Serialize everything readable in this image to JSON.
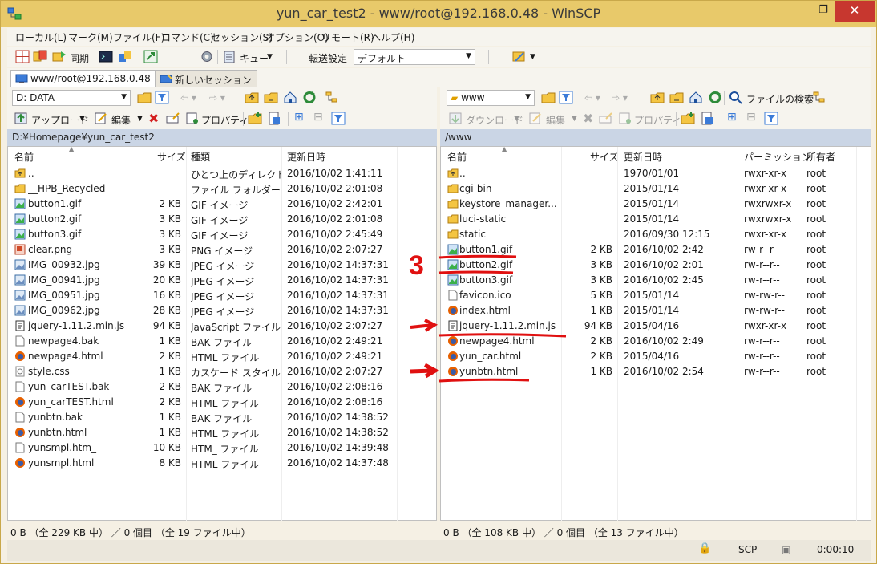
{
  "window": {
    "title": "yun_car_test2 - www/root@192.168.0.48 - WinSCP",
    "minimize_glyph": "—",
    "maximize_glyph": "❐",
    "close_glyph": "✕"
  },
  "menu": [
    "ローカル(L)",
    "マーク(M)",
    "ファイル(F)",
    "コマンド(C)",
    "セッション(S)",
    "オプション(O)",
    "リモート(R)",
    "ヘルプ(H)"
  ],
  "toolbar": {
    "sync_label": "同期",
    "queue_label": "キュー",
    "transfer_label": "転送設定",
    "transfer_value": "デフォルト"
  },
  "tabs": {
    "session": "www/root@192.168.0.48",
    "new_session": "新しいセッション"
  },
  "left": {
    "drive": "D: DATA",
    "upload_label": "アップロード",
    "edit_label": "編集",
    "properties_label": "プロパティ",
    "path": "D:¥Homepage¥yun_car_test2",
    "columns": {
      "name": "名前",
      "size": "サイズ",
      "type": "種類",
      "modified": "更新日時"
    },
    "files": [
      {
        "name": "..",
        "size": "",
        "type": "ひとつ上のディレクトリ",
        "modified": "2016/10/02  1:41:11",
        "icon": "up-dir"
      },
      {
        "name": "__HPB_Recycled",
        "size": "",
        "type": "ファイル フォルダー",
        "modified": "2016/10/02  2:01:08",
        "icon": "folder"
      },
      {
        "name": "button1.gif",
        "size": "2 KB",
        "type": "GIF イメージ",
        "modified": "2016/10/02  2:42:01",
        "icon": "image"
      },
      {
        "name": "button2.gif",
        "size": "3 KB",
        "type": "GIF イメージ",
        "modified": "2016/10/02  2:01:08",
        "icon": "image"
      },
      {
        "name": "button3.gif",
        "size": "3 KB",
        "type": "GIF イメージ",
        "modified": "2016/10/02  2:45:49",
        "icon": "image"
      },
      {
        "name": "clear.png",
        "size": "3 KB",
        "type": "PNG イメージ",
        "modified": "2016/10/02  2:07:27",
        "icon": "png"
      },
      {
        "name": "IMG_00932.jpg",
        "size": "39 KB",
        "type": "JPEG イメージ",
        "modified": "2016/10/02  14:37:31",
        "icon": "jpeg"
      },
      {
        "name": "IMG_00941.jpg",
        "size": "20 KB",
        "type": "JPEG イメージ",
        "modified": "2016/10/02  14:37:31",
        "icon": "jpeg"
      },
      {
        "name": "IMG_00951.jpg",
        "size": "16 KB",
        "type": "JPEG イメージ",
        "modified": "2016/10/02  14:37:31",
        "icon": "jpeg"
      },
      {
        "name": "IMG_00962.jpg",
        "size": "28 KB",
        "type": "JPEG イメージ",
        "modified": "2016/10/02  14:37:31",
        "icon": "jpeg"
      },
      {
        "name": "jquery-1.11.2.min.js",
        "size": "94 KB",
        "type": "JavaScript ファイル",
        "modified": "2016/10/02  2:07:27",
        "icon": "script"
      },
      {
        "name": "newpage4.bak",
        "size": "1 KB",
        "type": "BAK ファイル",
        "modified": "2016/10/02  2:49:21",
        "icon": "file"
      },
      {
        "name": "newpage4.html",
        "size": "2 KB",
        "type": "HTML ファイル",
        "modified": "2016/10/02  2:49:21",
        "icon": "firefox"
      },
      {
        "name": "style.css",
        "size": "1 KB",
        "type": "カスケード スタイル ...",
        "modified": "2016/10/02  2:07:27",
        "icon": "css"
      },
      {
        "name": "yun_carTEST.bak",
        "size": "2 KB",
        "type": "BAK ファイル",
        "modified": "2016/10/02  2:08:16",
        "icon": "file"
      },
      {
        "name": "yun_carTEST.html",
        "size": "2 KB",
        "type": "HTML ファイル",
        "modified": "2016/10/02  2:08:16",
        "icon": "firefox"
      },
      {
        "name": "yunbtn.bak",
        "size": "1 KB",
        "type": "BAK ファイル",
        "modified": "2016/10/02  14:38:52",
        "icon": "file"
      },
      {
        "name": "yunbtn.html",
        "size": "1 KB",
        "type": "HTML ファイル",
        "modified": "2016/10/02  14:38:52",
        "icon": "firefox"
      },
      {
        "name": "yunsmpl.htm_",
        "size": "10 KB",
        "type": "HTM_ ファイル",
        "modified": "2016/10/02  14:39:48",
        "icon": "file"
      },
      {
        "name": "yunsmpl.html",
        "size": "8 KB",
        "type": "HTML ファイル",
        "modified": "2016/10/02  14:37:48",
        "icon": "firefox"
      }
    ],
    "status": "0 B （全 229 KB 中） ／ 0 個目 （全 19 ファイル中）"
  },
  "right": {
    "dir": "www",
    "find_label": "ファイルの検索",
    "download_label": "ダウンロード",
    "edit_label": "編集",
    "properties_label": "プロパティ",
    "path": "/www",
    "columns": {
      "name": "名前",
      "size": "サイズ",
      "modified": "更新日時",
      "permissions": "パーミッション",
      "owner": "所有者"
    },
    "files": [
      {
        "name": "..",
        "size": "",
        "modified": "1970/01/01",
        "permissions": "rwxr-xr-x",
        "owner": "root",
        "icon": "up-dir"
      },
      {
        "name": "cgi-bin",
        "size": "",
        "modified": "2015/01/14",
        "permissions": "rwxr-xr-x",
        "owner": "root",
        "icon": "folder"
      },
      {
        "name": "keystore_manager...",
        "size": "",
        "modified": "2015/01/14",
        "permissions": "rwxrwxr-x",
        "owner": "root",
        "icon": "folder"
      },
      {
        "name": "luci-static",
        "size": "",
        "modified": "2015/01/14",
        "permissions": "rwxrwxr-x",
        "owner": "root",
        "icon": "folder"
      },
      {
        "name": "static",
        "size": "",
        "modified": "2016/09/30 12:15",
        "permissions": "rwxr-xr-x",
        "owner": "root",
        "icon": "folder"
      },
      {
        "name": "button1.gif",
        "size": "2 KB",
        "modified": "2016/10/02 2:42",
        "permissions": "rw-r--r--",
        "owner": "root",
        "icon": "image"
      },
      {
        "name": "button2.gif",
        "size": "3 KB",
        "modified": "2016/10/02 2:01",
        "permissions": "rw-r--r--",
        "owner": "root",
        "icon": "image"
      },
      {
        "name": "button3.gif",
        "size": "3 KB",
        "modified": "2016/10/02 2:45",
        "permissions": "rw-r--r--",
        "owner": "root",
        "icon": "image"
      },
      {
        "name": "favicon.ico",
        "size": "5 KB",
        "modified": "2015/01/14",
        "permissions": "rw-rw-r--",
        "owner": "root",
        "icon": "file"
      },
      {
        "name": "index.html",
        "size": "1 KB",
        "modified": "2015/01/14",
        "permissions": "rw-rw-r--",
        "owner": "root",
        "icon": "firefox"
      },
      {
        "name": "jquery-1.11.2.min.js",
        "size": "94 KB",
        "modified": "2015/04/16",
        "permissions": "rwxr-xr-x",
        "owner": "root",
        "icon": "script"
      },
      {
        "name": "newpage4.html",
        "size": "2 KB",
        "modified": "2016/10/02 2:49",
        "permissions": "rw-r--r--",
        "owner": "root",
        "icon": "firefox"
      },
      {
        "name": "yun_car.html",
        "size": "2 KB",
        "modified": "2015/04/16",
        "permissions": "rw-r--r--",
        "owner": "root",
        "icon": "firefox"
      },
      {
        "name": "yunbtn.html",
        "size": "1 KB",
        "modified": "2016/10/02 2:54",
        "permissions": "rw-r--r--",
        "owner": "root",
        "icon": "firefox"
      }
    ],
    "status": "0 B （全 108 KB 中） ／ 0 個目 （全 13 ファイル中）"
  },
  "bottom": {
    "protocol": "SCP",
    "elapsed": "0:00:10"
  },
  "annotation": {
    "number": "3",
    "color": "#e01010"
  }
}
